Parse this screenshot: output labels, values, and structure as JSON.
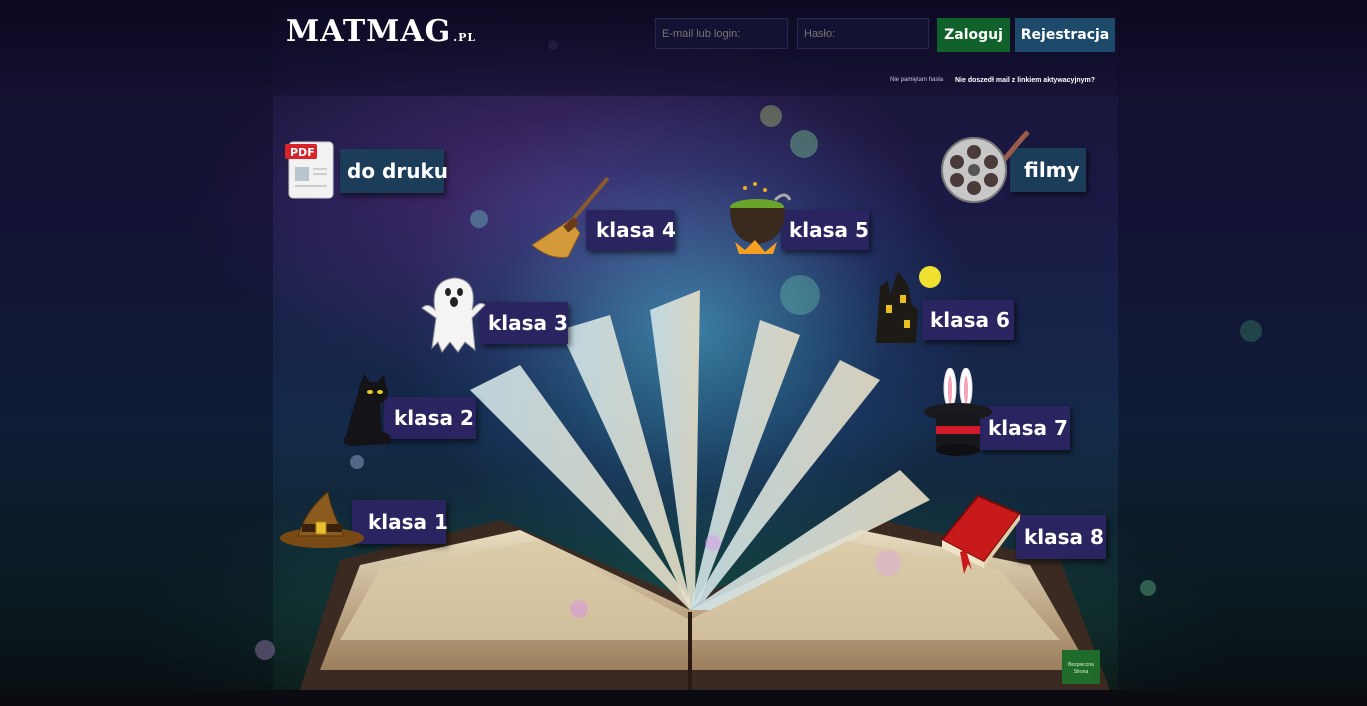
{
  "header": {
    "logo_main": "MATMAG",
    "logo_suffix": ".PL",
    "email_placeholder": "E-mail lub login:",
    "password_placeholder": "Hasło:",
    "login_label": "Zaloguj",
    "register_label": "Rejestracja",
    "forgot_password": "Nie pamiętam hasła",
    "resend_activation": "Nie doszedł mail z linkiem aktywacyjnym?"
  },
  "menu": {
    "print": "do druku",
    "films": "filmy",
    "klasa1": "klasa 1",
    "klasa2": "klasa 2",
    "klasa3": "klasa 3",
    "klasa4": "klasa 4",
    "klasa5": "klasa 5",
    "klasa6": "klasa 6",
    "klasa7": "klasa 7",
    "klasa8": "klasa 8"
  },
  "pdf_badge": "PDF",
  "footer_badge": "Bezpieczna Strona",
  "colors": {
    "label_bg": "#2a2560",
    "teal_label_bg": "#1c3d5a",
    "login_green": "#11612a",
    "register_blue": "#1d4a6b"
  }
}
